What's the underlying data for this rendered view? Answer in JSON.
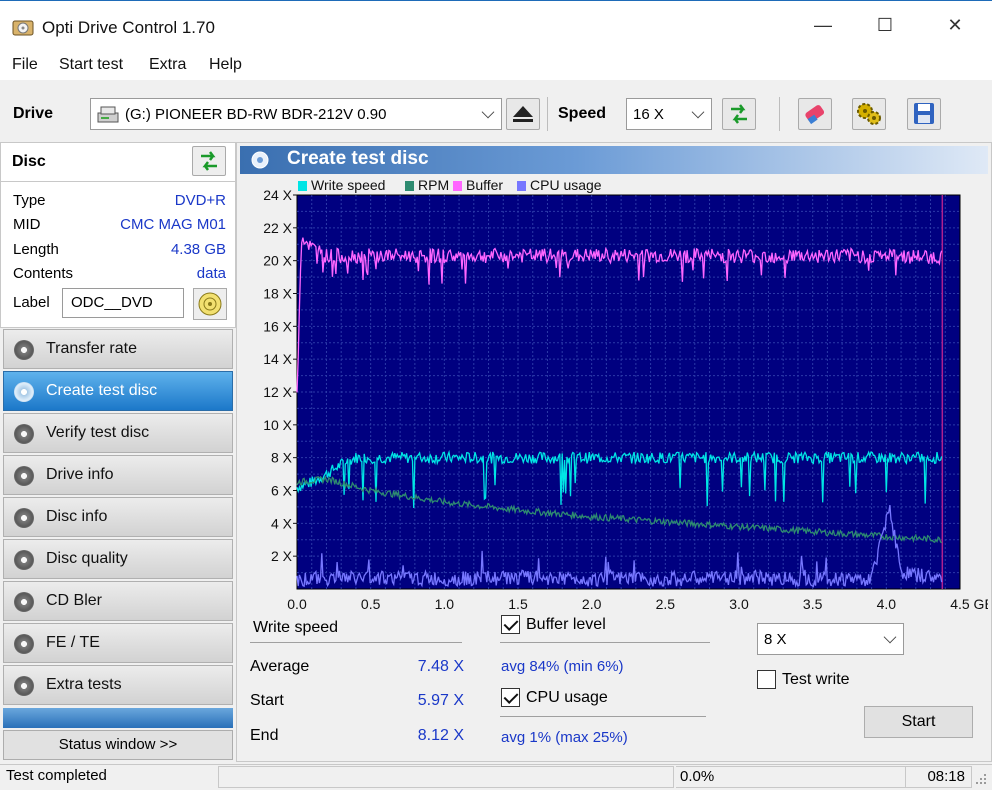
{
  "window": {
    "title": "Opti Drive Control 1.70",
    "minimize": "—",
    "maximize": "☐",
    "close": "✕"
  },
  "menu": [
    "File",
    "Start test",
    "Extra",
    "Help"
  ],
  "toolbar": {
    "drive_label": "Drive",
    "drive_value": "(G:)  PIONEER BD-RW   BDR-212V 0.90",
    "speed_label": "Speed",
    "speed_value": "16 X"
  },
  "disc": {
    "heading": "Disc",
    "rows": [
      {
        "key": "Type",
        "value": "DVD+R"
      },
      {
        "key": "MID",
        "value": "CMC MAG M01"
      },
      {
        "key": "Length",
        "value": "4.38 GB"
      },
      {
        "key": "Contents",
        "value": "data"
      }
    ],
    "label_key": "Label",
    "label_value": "ODC__DVD"
  },
  "nav": [
    "Transfer rate",
    "Create test disc",
    "Verify test disc",
    "Drive info",
    "Disc info",
    "Disc quality",
    "CD Bler",
    "FE / TE",
    "Extra tests"
  ],
  "nav_active_index": 1,
  "status_window_button": "Status window >>",
  "panel": {
    "title": "Create test disc",
    "legend": [
      {
        "name": "Write speed",
        "color": "#00e5e5"
      },
      {
        "name": "RPM",
        "color": "#2e8b70"
      },
      {
        "name": "Buffer",
        "color": "#ff66ff"
      },
      {
        "name": "CPU usage",
        "color": "#7777ff"
      }
    ]
  },
  "stats": {
    "write_speed_label": "Write speed",
    "average_label": "Average",
    "average_value": "7.48 X",
    "start_label": "Start",
    "start_value": "5.97 X",
    "end_label": "End",
    "end_value": "8.12 X",
    "buffer_level_label": "Buffer level",
    "buffer_level_value": "avg 84% (min 6%)",
    "cpu_usage_label": "CPU usage",
    "cpu_usage_value": "avg 1% (max 25%)",
    "write_speed_select": "8 X",
    "test_write_label": "Test write",
    "start_button": "Start"
  },
  "statusbar": {
    "text": "Test completed",
    "progress": "0.0%",
    "time": "08:18"
  },
  "chart_data": {
    "type": "line",
    "x_unit": "GB",
    "xlim": [
      0,
      4.5
    ],
    "ylim": [
      0,
      24
    ],
    "x_ticks": [
      "0.0",
      "0.5",
      "1.0",
      "1.5",
      "2.0",
      "2.5",
      "3.0",
      "3.5",
      "4.0",
      "4.5 GB"
    ],
    "y_ticks": [
      "2 X",
      "4 X",
      "6 X",
      "8 X",
      "10 X",
      "12 X",
      "14 X",
      "16 X",
      "18 X",
      "20 X",
      "22 X",
      "24 X"
    ],
    "grid": true,
    "end_marker_x": 4.38,
    "series": [
      {
        "name": "Write speed",
        "color": "#00e5e5",
        "x": [
          0,
          0.1,
          0.2,
          0.3,
          0.4,
          0.5,
          1.0,
          1.5,
          2.0,
          2.5,
          3.0,
          3.5,
          4.0,
          4.38
        ],
        "y": [
          6.2,
          6.5,
          7.0,
          7.6,
          8.0,
          8.0,
          8.0,
          8.0,
          8.0,
          8.0,
          8.0,
          8.0,
          8.0,
          8.0
        ]
      },
      {
        "name": "RPM",
        "color": "#2e8b70",
        "x": [
          0,
          0.2,
          0.5,
          1.0,
          1.5,
          2.0,
          2.5,
          3.0,
          3.5,
          4.0,
          4.38
        ],
        "y": [
          6.5,
          6.7,
          6.0,
          5.3,
          4.8,
          4.4,
          4.1,
          3.8,
          3.5,
          3.2,
          3.0
        ]
      },
      {
        "name": "Buffer",
        "color": "#ff66ff",
        "x": [
          0,
          0.03,
          0.1,
          0.2,
          1.0,
          2.0,
          3.0,
          4.0,
          4.38
        ],
        "y": [
          12,
          21.5,
          20.8,
          20.3,
          20.3,
          20.3,
          20.3,
          20.3,
          20.2
        ]
      },
      {
        "name": "CPU usage",
        "color": "#7777ff",
        "x": [
          0,
          0.5,
          1.0,
          1.5,
          2.0,
          2.5,
          3.0,
          3.5,
          3.9,
          4.02,
          4.1,
          4.38
        ],
        "y": [
          0.6,
          0.7,
          0.6,
          0.7,
          0.6,
          0.6,
          0.7,
          0.6,
          0.6,
          5.1,
          1.0,
          0.6
        ]
      }
    ]
  }
}
